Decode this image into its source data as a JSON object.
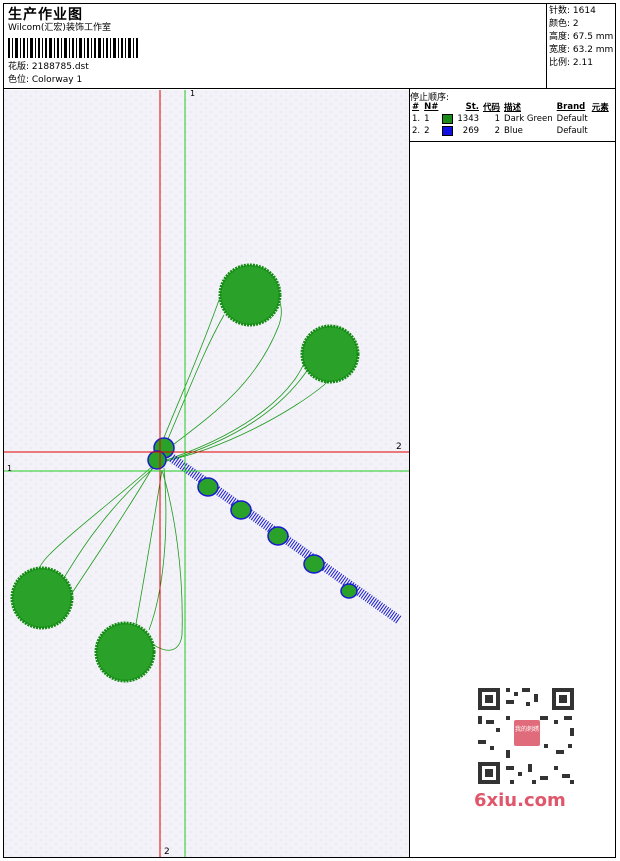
{
  "header": {
    "title": "生产作业图",
    "company": "Wilcom(汇宏)装饰工作室",
    "design_label": "花版: 2188785.dst",
    "colorway_label": "色位: Colorway 1"
  },
  "stats": {
    "stitches": "针数: 1614",
    "colors": "颜色: 2",
    "height": "高度: 67.5 mm",
    "width": "宽度: 63.2 mm",
    "ratio": "比例: 2.11"
  },
  "stop_sequence": {
    "heading": "停止顺序:",
    "columns": [
      "#",
      "N#",
      "St.",
      "代码",
      "描述",
      "Brand",
      "元素"
    ],
    "rows": [
      {
        "index": "1.",
        "needle": "1",
        "swatch_color": "#1a8a1a",
        "stitches": "1343",
        "code": "1",
        "description": "Dark Green",
        "brand": "Default"
      },
      {
        "index": "2.",
        "needle": "2",
        "swatch_color": "#1010e0",
        "stitches": "269",
        "code": "2",
        "description": "Blue",
        "brand": "Default"
      }
    ]
  },
  "guides": {
    "green_vertical_label": "1",
    "green_horizontal_label": "1",
    "red_horizontal_label": "2",
    "red_vertical_label": "2"
  },
  "watermark": {
    "site": "6xiu.com",
    "qr_center": "我的刺绣"
  },
  "colors": {
    "green_thread": "#1a9a1a",
    "blue_thread": "#1a1ad0",
    "guide_red": "#e00000",
    "guide_green": "#22cc22"
  }
}
